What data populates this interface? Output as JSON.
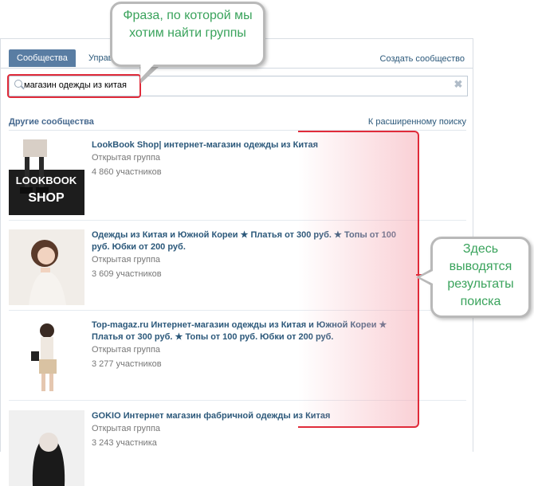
{
  "tabs": [
    {
      "label": "Сообщества"
    },
    {
      "label": "Управле"
    }
  ],
  "create_link": "Создать сообщество",
  "search": {
    "value": "магазин одежды из китая",
    "clear_glyph": "✖"
  },
  "section": {
    "title": "Другие сообщества",
    "advanced_link": "К расширенному поиску"
  },
  "results": [
    {
      "title": "LookBook Shop| интернет-магазин одежды из Китая",
      "type": "Открытая группа",
      "members": "4 860 участников",
      "thumb_text": [
        "LOOKBOOK",
        "SHOP"
      ]
    },
    {
      "title": "Одежды из Китая и Южной Кореи ★ Платья от 300 руб. ★ Топы от 100 руб. Юбки от 200 руб.",
      "type": "Открытая группа",
      "members": "3 609 участников"
    },
    {
      "title": "Top-magaz.ru Интернет-магазин одежды из Китая и Южной Кореи ★ Платья от 300 руб. ★ Топы от 100 руб. Юбки от 200 руб.",
      "type": "Открытая группа",
      "members": "3 277 участников"
    },
    {
      "title": "GOKIO Интернет магазин фабричной одежды из Китая",
      "type": "Открытая группа",
      "members": "3 243 участника"
    }
  ],
  "callouts": {
    "search_phrase": "Фраза, по которой мы хотим найти группы",
    "results_note": "Здесь выводятся результаты поиска"
  },
  "colors": {
    "accent": "#597da3",
    "link": "#2b587a",
    "highlight": "#e02b3a",
    "callout_text": "#3aa35c"
  }
}
